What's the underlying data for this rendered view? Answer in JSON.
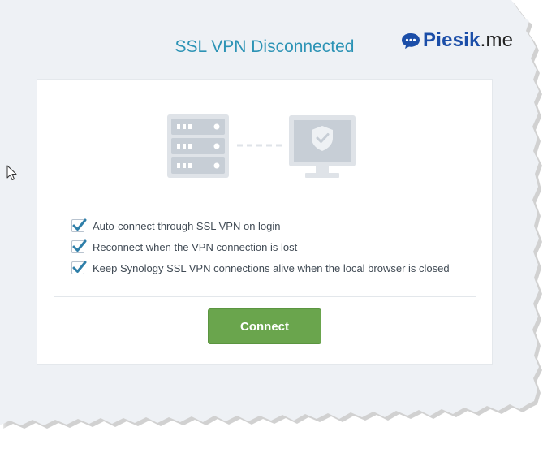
{
  "dialog": {
    "title": "SSL VPN Disconnected"
  },
  "brand": {
    "logo_icon": "speech-bubble-icon",
    "name": "Piesik",
    "suffix": ".me",
    "color": "#1b4ea8"
  },
  "illustration": {
    "left_icon": "server-icon",
    "right_icon": "monitor-shield-icon",
    "connector": "dashed-line"
  },
  "options": [
    {
      "label": "Auto-connect through SSL VPN on login",
      "checked": true
    },
    {
      "label": "Reconnect when the VPN connection is lost",
      "checked": true
    },
    {
      "label": "Keep Synology SSL VPN connections alive when the local browser is closed",
      "checked": true
    }
  ],
  "actions": {
    "connect_label": "Connect"
  },
  "colors": {
    "title": "#2c93b5",
    "check": "#2f7fa9",
    "connect_button": "#6aa54d",
    "background": "#eef1f5"
  }
}
